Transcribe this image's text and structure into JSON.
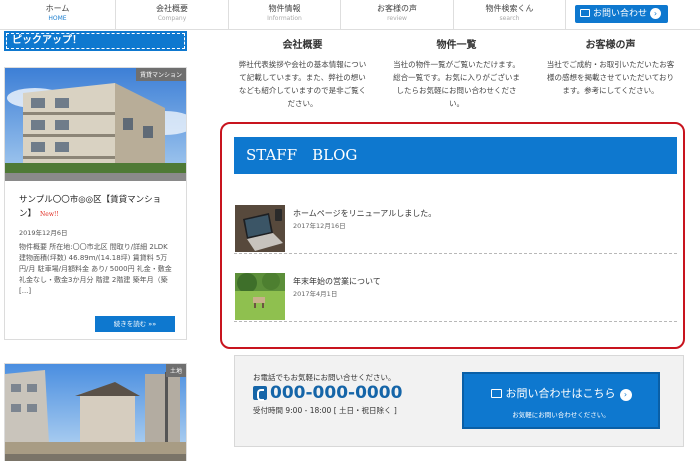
{
  "nav": {
    "items": [
      {
        "label": "ホーム",
        "sub": "HOME"
      },
      {
        "label": "会社概要",
        "sub": "Company"
      },
      {
        "label": "物件情報",
        "sub": "Information"
      },
      {
        "label": "お客様の声",
        "sub": "review"
      },
      {
        "label": "物件検索くん",
        "sub": "search"
      }
    ],
    "contact_label": "お問い合わせ"
  },
  "pickup": {
    "heading": "ピックアップ！",
    "card1": {
      "tag": "賃貸マンション",
      "title": "サンプル〇〇市◎◎区【賃貸マンション】",
      "new_label": "New!!",
      "date": "2019年12月6日",
      "description": "物件概要 所在地:〇〇市北区 間取り/詳細 2LDK 建物面積(坪数) 46.89m/(14.18坪) 賃貸料 5万円/月 駐車場/月額料金 あり/ 5000円 礼金・敷金 礼金なし・敷金3か月分 階建 2階建 築年月（築 [...]",
      "button": "続きを読む »»"
    },
    "card2": {
      "tag": "土地"
    }
  },
  "info_columns": [
    {
      "title": "会社概要",
      "text": "弊社代表挨拶や会社の基本情報について記載しています。また、弊社の想いなども紹介していますので是非ご覧ください。"
    },
    {
      "title": "物件一覧",
      "text": "当社の物件一覧がご覧いただけます。総合一覧です。お気に入りがございましたらお気軽にお問い合わせください。"
    },
    {
      "title": "お客様の声",
      "text": "当社でご成約・お取引いただいたお客様の感想を掲載させていただいております。参考にしてください。"
    }
  ],
  "blog": {
    "heading": "STAFF　BLOG",
    "posts": [
      {
        "title": "ホームページをリニューアルしました。",
        "date": "2017年12月16日"
      },
      {
        "title": "年末年始の営業について",
        "date": "2017年4月1日"
      }
    ]
  },
  "contact": {
    "lead": "お電話でもお気軽にお問い合せください。",
    "phone": "000-000-0000",
    "hours": "受付時間 9:00 - 18:00 [ 土日・祝日除く ]",
    "button_title": "お問い合わせはこちら",
    "button_sub": "お気軽にお問い合わせください。"
  },
  "colors": {
    "accent": "#0e78cf",
    "highlight_border": "#c8141e",
    "new_badge": "#e0281e"
  }
}
